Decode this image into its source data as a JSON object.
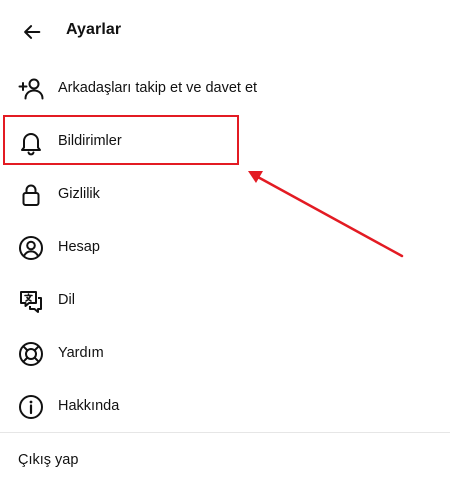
{
  "header": {
    "title": "Ayarlar",
    "back_icon": "arrow-left-icon"
  },
  "menu": {
    "items": [
      {
        "label": "Arkadaşları takip et ve davet et",
        "icon": "add-person-icon"
      },
      {
        "label": "Bildirimler",
        "icon": "bell-icon"
      },
      {
        "label": "Gizlilik",
        "icon": "lock-icon"
      },
      {
        "label": "Hesap",
        "icon": "account-circle-icon"
      },
      {
        "label": "Dil",
        "icon": "language-icon"
      },
      {
        "label": "Yardım",
        "icon": "lifebuoy-icon"
      },
      {
        "label": "Hakkında",
        "icon": "info-icon"
      }
    ]
  },
  "footer": {
    "logout_label": "Çıkış yap"
  },
  "annotation": {
    "highlighted_item": "Bildirimler",
    "color": "#e31b23"
  }
}
